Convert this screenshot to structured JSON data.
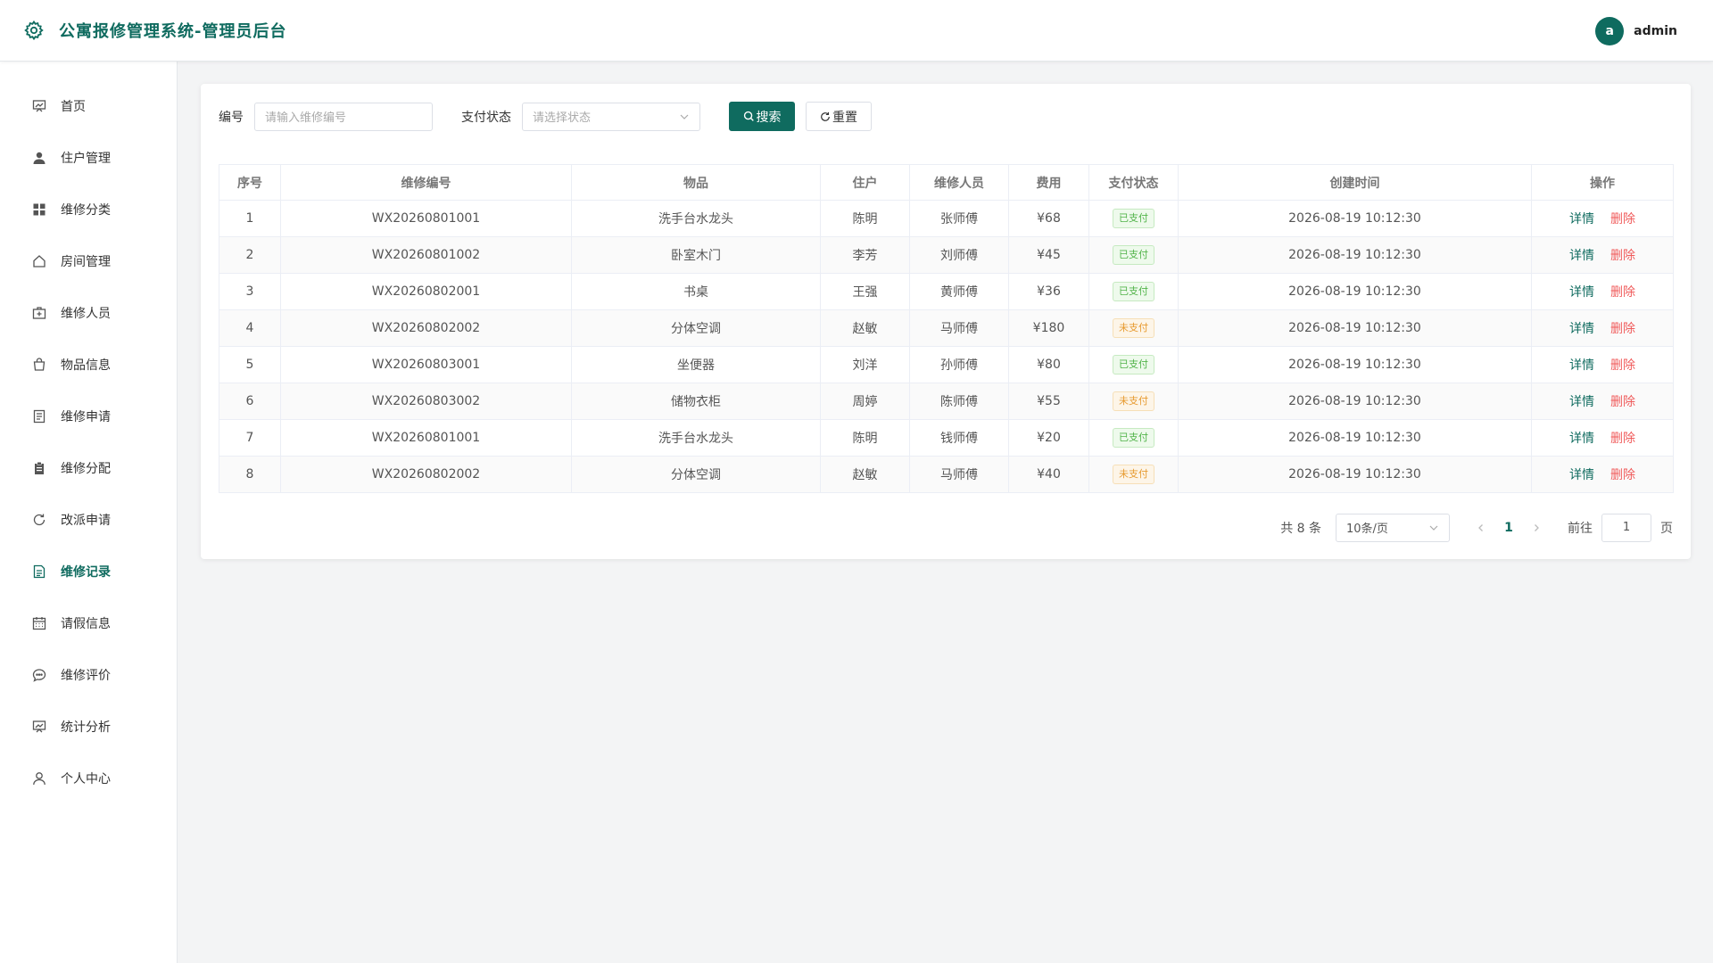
{
  "app": {
    "title": "公寓报修管理系统-管理员后台",
    "brand_color": "#0f6b5f"
  },
  "user": {
    "avatar_letter": "a",
    "name": "admin"
  },
  "sidebar": {
    "items": [
      {
        "label": "首页",
        "icon": "dashboard-icon"
      },
      {
        "label": "住户管理",
        "icon": "user-icon"
      },
      {
        "label": "维修分类",
        "icon": "grid-icon"
      },
      {
        "label": "房间管理",
        "icon": "house-icon"
      },
      {
        "label": "维修人员",
        "icon": "medical-bag-icon"
      },
      {
        "label": "物品信息",
        "icon": "shopping-bag-icon"
      },
      {
        "label": "维修申请",
        "icon": "document-icon"
      },
      {
        "label": "维修分配",
        "icon": "clipboard-icon"
      },
      {
        "label": "改派申请",
        "icon": "refresh-icon"
      },
      {
        "label": "维修记录",
        "icon": "document-lines-icon",
        "active": true
      },
      {
        "label": "请假信息",
        "icon": "calendar-icon"
      },
      {
        "label": "维修评价",
        "icon": "chat-bubble-icon"
      },
      {
        "label": "统计分析",
        "icon": "chart-board-icon"
      },
      {
        "label": "个人中心",
        "icon": "person-icon"
      }
    ]
  },
  "filters": {
    "code_label": "编号",
    "code_placeholder": "请输入维修编号",
    "status_label": "支付状态",
    "status_placeholder": "请选择状态",
    "search_label": "搜索",
    "reset_label": "重置"
  },
  "table": {
    "headers": [
      "序号",
      "维修编号",
      "物品",
      "住户",
      "维修人员",
      "费用",
      "支付状态",
      "创建时间",
      "操作"
    ],
    "rows": [
      {
        "idx": "1",
        "code": "WX20260801001",
        "item": "洗手台水龙头",
        "resident": "陈明",
        "worker": "张师傅",
        "fee": "¥68",
        "status": "已支付",
        "paid": true,
        "time": "2026-08-19 10:12:30"
      },
      {
        "idx": "2",
        "code": "WX20260801002",
        "item": "卧室木门",
        "resident": "李芳",
        "worker": "刘师傅",
        "fee": "¥45",
        "status": "已支付",
        "paid": true,
        "time": "2026-08-19 10:12:30"
      },
      {
        "idx": "3",
        "code": "WX20260802001",
        "item": "书桌",
        "resident": "王强",
        "worker": "黄师傅",
        "fee": "¥36",
        "status": "已支付",
        "paid": true,
        "time": "2026-08-19 10:12:30"
      },
      {
        "idx": "4",
        "code": "WX20260802002",
        "item": "分体空调",
        "resident": "赵敏",
        "worker": "马师傅",
        "fee": "¥180",
        "status": "未支付",
        "paid": false,
        "time": "2026-08-19 10:12:30"
      },
      {
        "idx": "5",
        "code": "WX20260803001",
        "item": "坐便器",
        "resident": "刘洋",
        "worker": "孙师傅",
        "fee": "¥80",
        "status": "已支付",
        "paid": true,
        "time": "2026-08-19 10:12:30"
      },
      {
        "idx": "6",
        "code": "WX20260803002",
        "item": "储物衣柜",
        "resident": "周婷",
        "worker": "陈师傅",
        "fee": "¥55",
        "status": "未支付",
        "paid": false,
        "time": "2026-08-19 10:12:30"
      },
      {
        "idx": "7",
        "code": "WX20260801001",
        "item": "洗手台水龙头",
        "resident": "陈明",
        "worker": "钱师傅",
        "fee": "¥20",
        "status": "已支付",
        "paid": true,
        "time": "2026-08-19 10:12:30"
      },
      {
        "idx": "8",
        "code": "WX20260802002",
        "item": "分体空调",
        "resident": "赵敏",
        "worker": "马师傅",
        "fee": "¥40",
        "status": "未支付",
        "paid": false,
        "time": "2026-08-19 10:12:30"
      }
    ],
    "detail_label": "详情",
    "delete_label": "删除"
  },
  "pagination": {
    "total": "共 8 条",
    "page_size": "10条/页",
    "current": "1",
    "goto_label": "前往",
    "goto_value": "1",
    "page_suffix": "页"
  },
  "colors": {
    "paid": "#52b44a",
    "unpaid": "#e79a2f",
    "delete": "#f05b5b"
  }
}
